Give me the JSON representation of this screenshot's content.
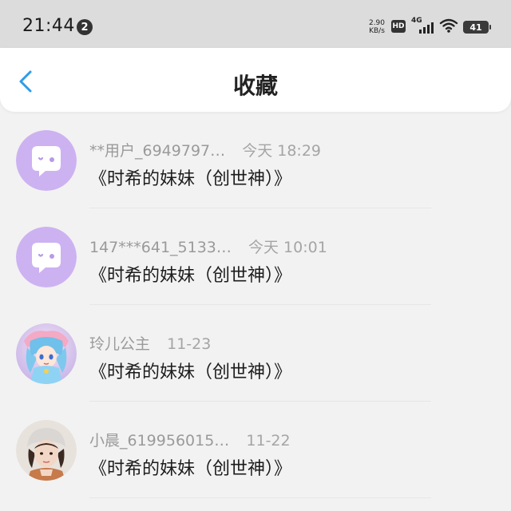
{
  "status_bar": {
    "time": "21:44",
    "notification_count": "2",
    "net_speed_value": "2.90",
    "net_speed_unit": "KB/s",
    "hd_label": "HD",
    "signal_label": "4G",
    "battery_level": "41"
  },
  "header": {
    "title": "收藏",
    "back_icon": "chevron-left-icon"
  },
  "favorites": [
    {
      "name": "**用户_6949797…",
      "time": "今天 18:29",
      "title": "《时希的妹妹（创世神）》",
      "avatar": "default-chat-avatar"
    },
    {
      "name": "147***641_5133…",
      "time": "今天 10:01",
      "title": "《时希的妹妹（创世神）》",
      "avatar": "default-chat-avatar"
    },
    {
      "name": "玲儿公主",
      "time": "11-23",
      "title": "《时希的妹妹（创世神）》",
      "avatar": "anime-character-avatar"
    },
    {
      "name": "小晨_619956015…",
      "time": "11-22",
      "title": "《时希的妹妹（创世神）》",
      "avatar": "photo-avatar"
    }
  ],
  "colors": {
    "accent": "#2f9be8",
    "default_avatar_bg": "#cdb2f2"
  }
}
